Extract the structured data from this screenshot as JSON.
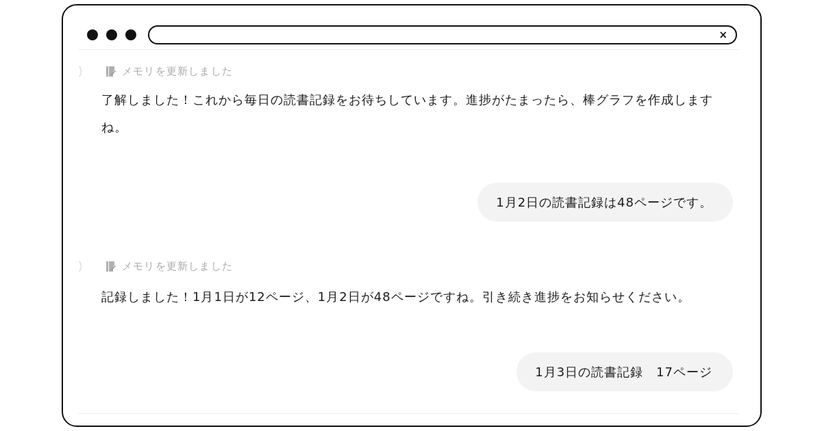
{
  "window": {
    "address_bar": {
      "close": "×"
    }
  },
  "messages": [
    {
      "kind": "assistant",
      "memory_note": "メモリを更新しました",
      "text": "了解しました！これから毎日の読書記録をお待ちしています。進捗がたまったら、棒グラフを作成しますね。"
    },
    {
      "kind": "user",
      "text": "1月2日の読書記録は48ページです。"
    },
    {
      "kind": "assistant",
      "memory_note": "メモリを更新しました",
      "text": "記録しました！1月1日が12ページ、1月2日が48ページですね。引き続き進捗をお知らせください。"
    },
    {
      "kind": "user",
      "text": "1月3日の読書記録　17ページ"
    }
  ]
}
